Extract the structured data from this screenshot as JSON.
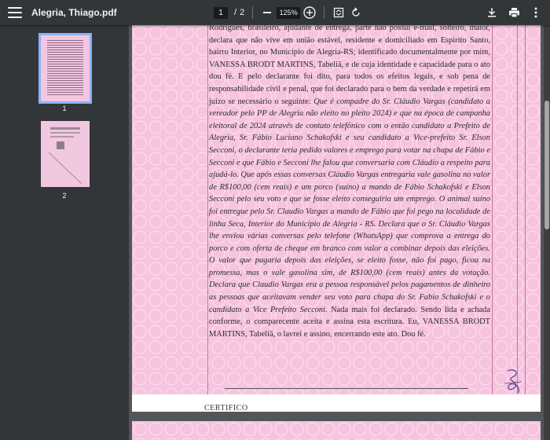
{
  "toolbar": {
    "title": "Alegria, Thiago.pdf",
    "page_current": "1",
    "page_total": "2",
    "zoom": "125%",
    "page_separator": "/"
  },
  "sidebar": {
    "thumbnails": [
      {
        "label": "1"
      },
      {
        "label": "2"
      }
    ]
  },
  "document": {
    "footer_partial": "CERTIFICO"
  },
  "colors": {
    "toolbar_bg": "#323639",
    "viewer_bg": "#525659",
    "page_bg": "#f7c4df",
    "thumb_selected": "#8ab4f8"
  }
}
